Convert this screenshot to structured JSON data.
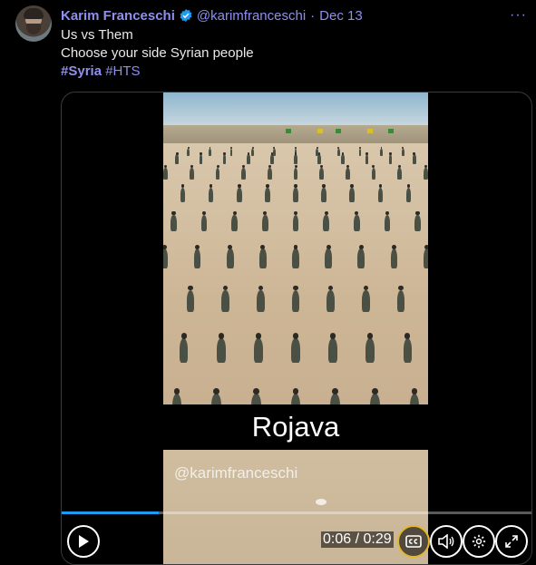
{
  "tweet": {
    "author_name": "Karim Franceschi",
    "handle": "@karimfranceschi",
    "separator": "·",
    "date": "Dec 13",
    "more_label": "···",
    "text_line1": "Us vs Them",
    "text_line2": "Choose your side Syrian people",
    "hashtags": [
      "#Syria",
      "#HTS"
    ]
  },
  "video": {
    "caption": "Rojava",
    "watermark": "@karimfranceschi",
    "time_display": "0:06 / 0:29",
    "progress_fraction": 0.207
  },
  "colors": {
    "background": "#000000",
    "link": "#8f8ff0",
    "verified": "#1d9bf0",
    "caption_focus": "#e5b82b"
  },
  "icons": {
    "verified": "verified-badge-icon",
    "play": "play-icon",
    "captions": "closed-captions-icon",
    "volume": "volume-icon",
    "settings": "settings-gear-icon",
    "fullscreen": "fullscreen-icon"
  }
}
